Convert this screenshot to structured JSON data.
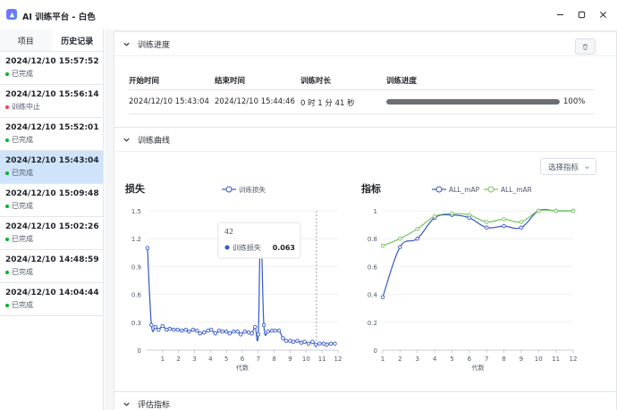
{
  "window": {
    "title": "AI 训练平台 - 白色"
  },
  "sidebar": {
    "tabs": [
      {
        "label": "项目",
        "active": false
      },
      {
        "label": "历史记录",
        "active": true
      }
    ],
    "history": [
      {
        "time": "2024/12/10 15:57:52",
        "status": "已完成",
        "status_color": "#00b42a",
        "selected": false
      },
      {
        "time": "2024/12/10 15:56:14",
        "status": "训练中止",
        "status_color": "#f53f3f",
        "selected": false
      },
      {
        "time": "2024/12/10 15:52:01",
        "status": "已完成",
        "status_color": "#00b42a",
        "selected": false
      },
      {
        "time": "2024/12/10 15:43:04",
        "status": "已完成",
        "status_color": "#00b42a",
        "selected": true
      },
      {
        "time": "2024/12/10 15:09:48",
        "status": "已完成",
        "status_color": "#00b42a",
        "selected": false
      },
      {
        "time": "2024/12/10 15:02:26",
        "status": "已完成",
        "status_color": "#00b42a",
        "selected": false
      },
      {
        "time": "2024/12/10 14:48:59",
        "status": "已完成",
        "status_color": "#00b42a",
        "selected": false
      },
      {
        "time": "2024/12/10 14:04:44",
        "status": "已完成",
        "status_color": "#00b42a",
        "selected": false
      }
    ]
  },
  "progress_section": {
    "title": "训练进度",
    "headers": {
      "start": "开始时间",
      "end": "结束时间",
      "duration": "训练时长",
      "progress": "训练进度"
    },
    "row": {
      "start": "2024/12/10 15:43:04",
      "end": "2024/12/10 15:44:46",
      "duration": "0 时 1 分 41 秒",
      "progress_label": "100%",
      "progress_value": 100
    }
  },
  "curve_section": {
    "title": "训练曲线",
    "select_label": "选择指标"
  },
  "eval_section": {
    "title": "评估指标"
  },
  "colors": {
    "accent": "#3558c7",
    "green": "#77c35c",
    "selected_bg": "#cfe3fb"
  },
  "chart_data": [
    {
      "type": "line",
      "title": "损失",
      "xlabel": "代数",
      "ylabel": "",
      "series": [
        {
          "name": "训练损失",
          "x": [
            0.05,
            0.3,
            0.55,
            0.75,
            1.0,
            1.25,
            1.45,
            1.7,
            1.95,
            2.2,
            2.45,
            2.65,
            2.9,
            3.15,
            3.35,
            3.6,
            3.85,
            4.05,
            4.3,
            4.55,
            4.75,
            5.0,
            5.2,
            5.45,
            5.7,
            5.9,
            6.15,
            6.4,
            6.6,
            6.8,
            7.0,
            7.15,
            7.35,
            7.6,
            7.85,
            8.05,
            8.3,
            8.55,
            8.75,
            9.0,
            9.2,
            9.45,
            9.7,
            9.9,
            10.15,
            10.4,
            10.6,
            10.85,
            11.1,
            11.3,
            11.55,
            11.8
          ],
          "values": [
            1.1,
            0.27,
            0.25,
            0.22,
            0.26,
            0.22,
            0.23,
            0.22,
            0.22,
            0.21,
            0.22,
            0.2,
            0.22,
            0.21,
            0.18,
            0.19,
            0.21,
            0.22,
            0.18,
            0.21,
            0.2,
            0.2,
            0.18,
            0.2,
            0.2,
            0.17,
            0.2,
            0.19,
            0.18,
            0.25,
            0.17,
            1.35,
            0.27,
            0.2,
            0.21,
            0.21,
            0.21,
            0.13,
            0.1,
            0.1,
            0.09,
            0.1,
            0.08,
            0.09,
            0.07,
            0.09,
            0.06,
            0.07,
            0.07,
            0.06,
            0.07,
            0.07
          ]
        }
      ],
      "xticks": [
        1,
        2,
        3,
        4,
        5,
        6,
        7,
        8,
        9,
        10,
        11,
        12
      ],
      "yticks": [
        0,
        0.3,
        0.6,
        0.9,
        1.2,
        1.5
      ],
      "xlim": [
        0,
        12
      ],
      "ylim": [
        0,
        1.5
      ],
      "legend": "top",
      "tooltip": {
        "x_label": "42",
        "series_name": "训练损失",
        "value": "0.063"
      }
    },
    {
      "type": "line",
      "title": "指标",
      "xlabel": "代数",
      "ylabel": "",
      "series": [
        {
          "name": "ALL_mAP",
          "x": [
            1,
            2,
            3,
            4,
            5,
            6,
            7,
            8,
            9,
            10,
            11,
            12
          ],
          "values": [
            0.38,
            0.74,
            0.8,
            0.95,
            0.97,
            0.95,
            0.88,
            0.89,
            0.88,
            1,
            1,
            1
          ]
        },
        {
          "name": "ALL_mAR",
          "x": [
            1,
            2,
            3,
            4,
            5,
            6,
            7,
            8,
            9,
            10,
            11,
            12
          ],
          "values": [
            0.75,
            0.8,
            0.87,
            0.96,
            0.98,
            0.97,
            0.92,
            0.94,
            0.92,
            1,
            1,
            1
          ]
        }
      ],
      "xticks": [
        1,
        2,
        3,
        4,
        5,
        6,
        7,
        8,
        9,
        10,
        11,
        12
      ],
      "yticks": [
        0,
        0.2,
        0.4,
        0.6,
        0.8,
        1
      ],
      "xlim": [
        1,
        12
      ],
      "ylim": [
        0,
        1
      ],
      "legend": "top"
    }
  ]
}
